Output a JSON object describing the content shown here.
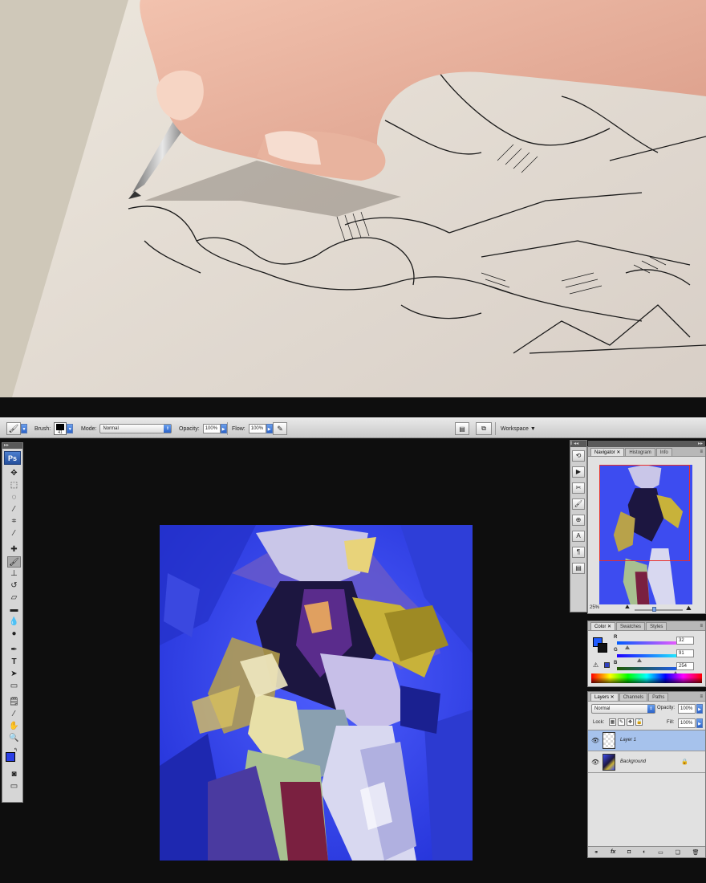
{
  "options_bar": {
    "brush_label": "Brush:",
    "brush_size": "41",
    "mode_label": "Mode:",
    "mode_value": "Normal",
    "opacity_label": "Opacity:",
    "opacity_value": "100%",
    "flow_label": "Flow:",
    "flow_value": "100%",
    "workspace_label": "Workspace ▼"
  },
  "toolbox": {
    "logo": "Ps",
    "tools": [
      "move-tool",
      "marquee-tool",
      "lasso-tool",
      "magic-wand-tool",
      "crop-tool",
      "slice-tool",
      "healing-brush-tool",
      "brush-tool",
      "clone-stamp-tool",
      "history-brush-tool",
      "eraser-tool",
      "gradient-tool",
      "blur-tool",
      "dodge-tool",
      "pen-tool",
      "type-tool",
      "path-selection-tool",
      "shape-tool",
      "notes-tool",
      "eyedropper-tool",
      "hand-tool",
      "zoom-tool"
    ],
    "foreground_color": "#2b3fe6",
    "background_color": "#20205a"
  },
  "navigator": {
    "tabs": [
      "Navigator",
      "Histogram",
      "Info"
    ],
    "zoom": "25%"
  },
  "color_panel": {
    "tabs": [
      "Color",
      "Swatches",
      "Styles"
    ],
    "r_label": "R",
    "g_label": "G",
    "b_label": "B",
    "r_value": "32",
    "g_value": "91",
    "b_value": "254",
    "swatch": "#205bfe"
  },
  "layers_panel": {
    "tabs": [
      "Layers",
      "Channels",
      "Paths"
    ],
    "blend_mode": "Normal",
    "opacity_label": "Opacity:",
    "opacity_value": "100%",
    "lock_label": "Lock:",
    "fill_label": "Fill:",
    "fill_value": "100%",
    "layers": [
      {
        "name": "Layer 1",
        "selected": true
      },
      {
        "name": "Background",
        "selected": false
      }
    ]
  }
}
